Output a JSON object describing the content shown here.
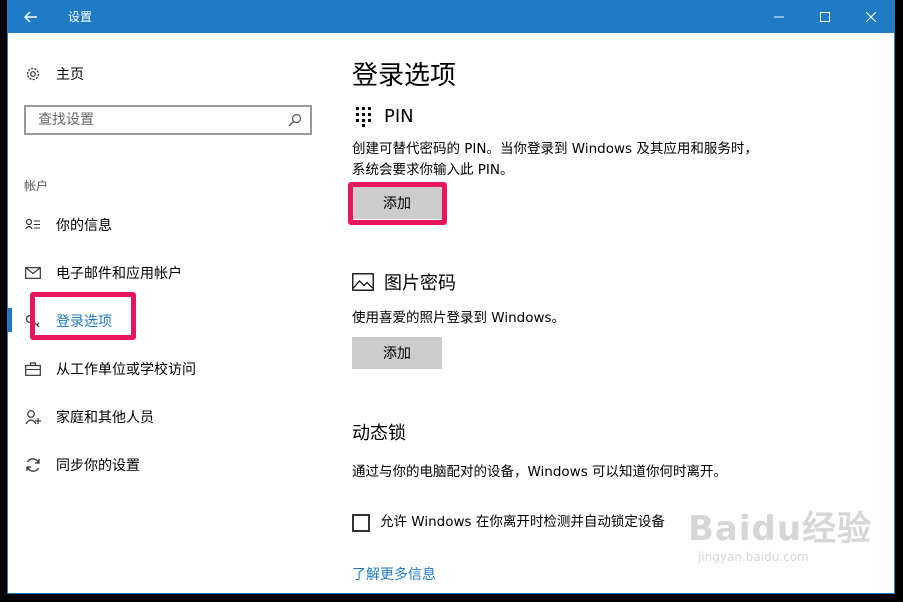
{
  "window": {
    "title": "设置",
    "accent": "#1f7bc4",
    "highlight_color": "#e8175d",
    "icons": {
      "back": "arrow-left-icon",
      "minimize": "minimize-icon",
      "maximize": "maximize-icon",
      "close": "close-icon"
    }
  },
  "sidebar": {
    "home_label": "主页",
    "search_placeholder": "查找设置",
    "section_label": "帐户",
    "items": [
      {
        "label": "你的信息",
        "icon": "person-card-icon"
      },
      {
        "label": "电子邮件和应用帐户",
        "icon": "mail-icon"
      },
      {
        "label": "登录选项",
        "icon": "key-icon",
        "active": true
      },
      {
        "label": "从工作单位或学校访问",
        "icon": "briefcase-icon"
      },
      {
        "label": "家庭和其他人员",
        "icon": "person-add-icon"
      },
      {
        "label": "同步你的设置",
        "icon": "sync-icon"
      }
    ]
  },
  "main": {
    "title": "登录选项",
    "pin": {
      "heading": "PIN",
      "desc_line1": "创建可替代密码的 PIN。当你登录到 Windows 及其应用和服务时，",
      "desc_line2": "系统会要求你输入此 PIN。",
      "button": "添加"
    },
    "picture_password": {
      "heading": "图片密码",
      "desc": "使用喜爱的照片登录到 Windows。",
      "button": "添加"
    },
    "dynamic_lock": {
      "heading": "动态锁",
      "desc": "通过与你的电脑配对的设备，Windows 可以知道你何时离开。",
      "checkbox_label": "允许 Windows 在你离开时检测并自动锁定设备",
      "checked": false,
      "link": "了解更多信息"
    }
  },
  "watermark": {
    "big": "Baidu经验",
    "small": "jingyan.baidu.com"
  }
}
